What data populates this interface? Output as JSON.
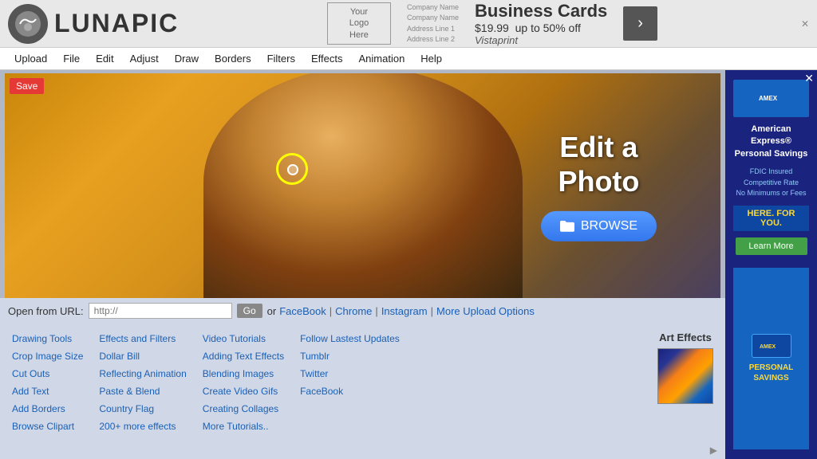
{
  "topAd": {
    "logoLine1": "Your",
    "logoLine2": "Logo",
    "logoLine3": "Here",
    "adTitle": "Business Cards",
    "adPrice": "$19.99",
    "adOffer": "up to 50% off",
    "adBrand": "Vistaprint",
    "adBtnLabel": "›",
    "closeLabel": "✕"
  },
  "logo": {
    "text": "LUNAPIC"
  },
  "navbar": {
    "items": [
      {
        "label": "Upload"
      },
      {
        "label": "File"
      },
      {
        "label": "Edit"
      },
      {
        "label": "Adjust"
      },
      {
        "label": "Draw"
      },
      {
        "label": "Borders"
      },
      {
        "label": "Filters"
      },
      {
        "label": "Effects"
      },
      {
        "label": "Animation"
      },
      {
        "label": "Help"
      }
    ]
  },
  "saveBtn": "Save",
  "hero": {
    "title": "Edit a\nPhoto",
    "browseBtn": "BROWSE"
  },
  "urlBar": {
    "label": "Open from URL:",
    "placeholder": "http://",
    "goBtn": "Go",
    "or": "or",
    "links": [
      {
        "label": "FaceBook"
      },
      {
        "label": "Chrome"
      },
      {
        "label": "Instagram"
      },
      {
        "label": "More Upload Options"
      }
    ]
  },
  "linksGrid": {
    "col1": {
      "title": null,
      "links": [
        "Drawing Tools",
        "Crop Image Size",
        "Cut Outs",
        "Add Text",
        "Add Borders",
        "Browse Clipart"
      ]
    },
    "col2": {
      "links": [
        "Effects and Filters",
        "Dollar Bill",
        "Reflecting Animation",
        "Paste & Blend",
        "Country Flag",
        "200+ more effects"
      ]
    },
    "col3": {
      "links": [
        "Video Tutorials",
        "Adding Text Effects",
        "Blending Images",
        "Create Video Gifs",
        "Creating Collages",
        "More Tutorials.."
      ]
    },
    "col4": {
      "links": [
        "Follow Lastest Updates",
        "Tumblr",
        "Twitter",
        "FaceBook"
      ]
    }
  },
  "artEffects": {
    "label": "Art Effects"
  },
  "rightAd": {
    "title": "American Express®\nPersonal Savings",
    "fdic": "FDIC Insured\nCompetitive Rate\nNo Minimums or Fees",
    "hereForYou": "HERE. FOR YOU.",
    "learnMore": "Learn More",
    "bottomLabel": "PERSONAL\nSAVINGS",
    "closeBtn": "✕"
  }
}
